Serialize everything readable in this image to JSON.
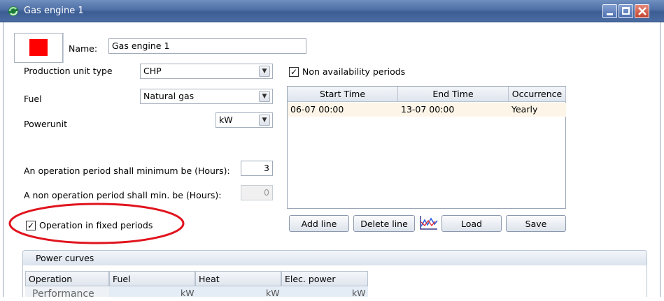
{
  "window": {
    "title": "Gas engine 1",
    "controls": [
      "minimize",
      "maximize",
      "close"
    ]
  },
  "unit": {
    "color": "#ff0000",
    "name_label": "Name:",
    "name_value": "Gas engine 1"
  },
  "left_panel": {
    "production_type_label": "Production unit type",
    "production_type_value": "CHP",
    "fuel_label": "Fuel",
    "fuel_value": "Natural gas",
    "powerunit_label": "Powerunit",
    "powerunit_value": "kW",
    "min_operation_label": "An operation period shall minimum be (Hours):",
    "min_operation_value": "3",
    "min_non_operation_label": "A non operation period shall min. be (Hours):",
    "min_non_operation_value": "0",
    "fixed_periods_label": "Operation in fixed periods",
    "fixed_periods_checked": true
  },
  "availability": {
    "checkbox_label": "Non availability periods",
    "checked": true,
    "columns": [
      "Start Time",
      "End Time",
      "Occurrence"
    ],
    "rows": [
      {
        "start": "06-07 00:00",
        "end": "13-07 00:00",
        "occurrence": "Yearly"
      }
    ],
    "buttons": {
      "add": "Add line",
      "delete": "Delete line",
      "load": "Load",
      "save": "Save"
    }
  },
  "power_curves": {
    "title": "Power curves",
    "columns": [
      "Operation",
      "Fuel",
      "Heat",
      "Elec. power"
    ],
    "row_label": "Performance",
    "units": [
      "kW",
      "kW",
      "kW"
    ]
  },
  "colors": {
    "highlight_ellipse": "#e0141e",
    "row_background": "#fdf6e8",
    "titlebar": "#4e6fa5"
  }
}
